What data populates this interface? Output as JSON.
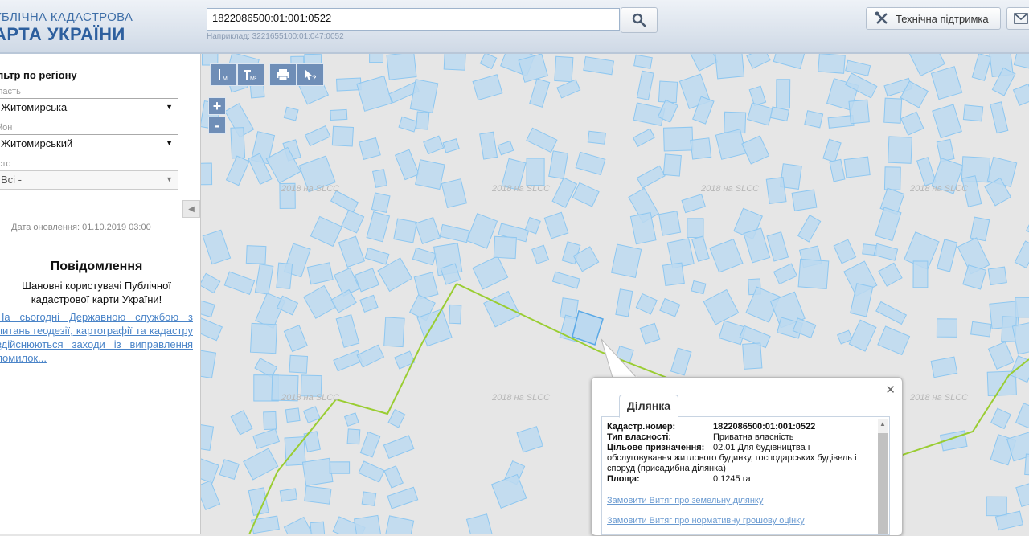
{
  "header": {
    "logo_line1": "УБЛІЧНА КАДАСТРОВА",
    "logo_line2": "АРТА УКРАЇНИ",
    "search_value": "1822086500:01:001:0522",
    "search_hint": "Наприклад: 3221655100:01:047:0052",
    "search_icon": "search-icon",
    "support_label": "Технічна підтримка",
    "support_icon": "tools-icon",
    "mail_icon": "mail-icon"
  },
  "sidebar": {
    "filter_title": "льтр по регіону",
    "oblast_label": "ласть",
    "oblast_value": "Житомирська",
    "rayon_label": "йон",
    "rayon_value": "Житомирський",
    "misto_label": "сто",
    "misto_value": "Всі -",
    "collapse_icon": "chevron-left-icon",
    "update_text": "Дата оновлення: 01.10.2019 03:00",
    "notice_title": "Повідомлення",
    "notice_text": "Шановні користувачі Публічної кадастрової карти України!",
    "notice_link": "На сьогодні Державною службою з питань геодезії, картографії та кадастру здійснюються заходи із виправлення помилок..."
  },
  "map": {
    "toolbar": [
      {
        "icon": "measure-distance-icon"
      },
      {
        "icon": "measure-area-icon"
      },
      {
        "icon": "print-icon"
      },
      {
        "icon": "identify-icon"
      }
    ],
    "zoom_in": "+",
    "zoom_out": "-",
    "watermark": "2018 на SLCC",
    "parcel_fill": "#bcd9f0",
    "parcel_stroke": "#8ec7f0",
    "boundary_color": "#9acd32"
  },
  "popup": {
    "tab_label": "Ділянка",
    "close_icon": "close-icon",
    "rows": [
      {
        "label": "Кадастр.номер:",
        "value": "1822086500:01:001:0522"
      },
      {
        "label": "Тип власності:",
        "value": "Приватна власність"
      },
      {
        "label": "Цільове призначення:",
        "value": "02.01 Для будівництва і"
      },
      {
        "label": "Площа:",
        "value": "0.1245 га"
      }
    ],
    "purpose_continued_1": "обслуговування житлового будинку, господарських будівель і",
    "purpose_continued_2": "споруд (присадибна ділянка)",
    "link1": "Замовити Витяг про земельну ділянку",
    "link2": "Замовити Витяг про нормативну грошову оцінку"
  }
}
